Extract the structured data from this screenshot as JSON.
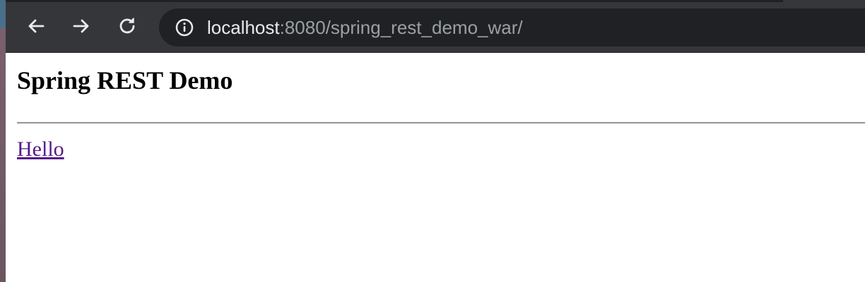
{
  "browser": {
    "address_bar": {
      "host": "localhost",
      "rest": ":8080/spring_rest_demo_war/"
    },
    "icons": {
      "back": "back-arrow-icon",
      "forward": "forward-arrow-icon",
      "reload": "reload-icon",
      "site_info": "info-icon"
    },
    "colors": {
      "toolbar": "#35363a",
      "omnibox": "#202124",
      "visited_link": "#551a8b"
    }
  },
  "page": {
    "title": "Spring REST Demo",
    "link_label": "Hello"
  }
}
